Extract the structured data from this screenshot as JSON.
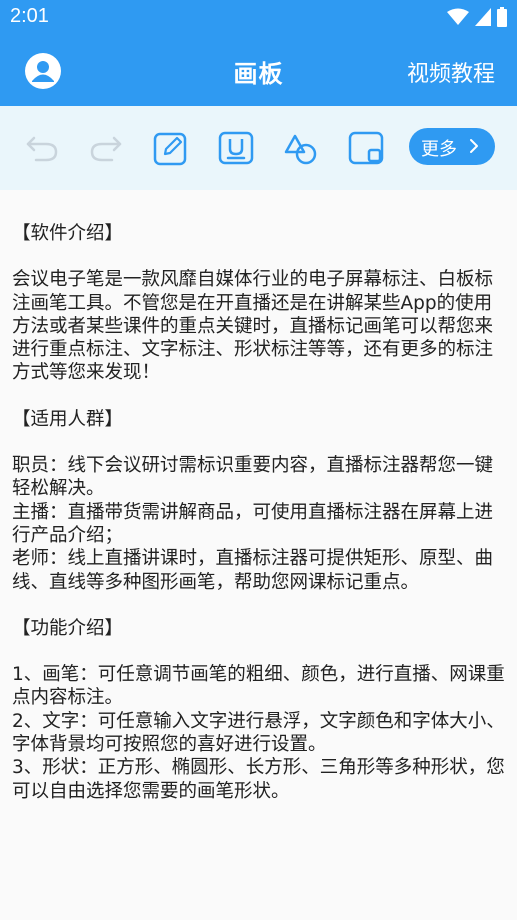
{
  "status": {
    "time": "2:01"
  },
  "header": {
    "title": "画板",
    "video_tutorial": "视频教程"
  },
  "toolbar": {
    "more_label": "更多",
    "colors": {
      "active": "#2f9af2",
      "disabled": "#c9d4dc"
    }
  },
  "content": {
    "s1_title": "【软件介绍】",
    "s1_body": "会议电子笔是一款风靡自媒体行业的电子屏幕标注、白板标注画笔工具。不管您是在开直播还是在讲解某些App的使用方法或者某些课件的重点关键时，直播标记画笔可以帮您来进行重点标注、文字标注、形状标注等等，还有更多的标注方式等您来发现！",
    "s2_title": "【适用人群】",
    "s2_item1": "职员：线下会议研讨需标识重要内容，直播标注器帮您一键轻松解决。",
    "s2_item2": "主播：直播带货需讲解商品，可使用直播标注器在屏幕上进行产品介绍；",
    "s2_item3": "老师：线上直播讲课时，直播标注器可提供矩形、原型、曲线、直线等多种图形画笔，帮助您网课标记重点。",
    "s3_title": "【功能介绍】",
    "s3_item1": "1、画笔：可任意调节画笔的粗细、颜色，进行直播、网课重点内容标注。",
    "s3_item2": "2、文字：可任意输入文字进行悬浮，文字颜色和字体大小、字体背景均可按照您的喜好进行设置。",
    "s3_item3": "3、形状：正方形、椭圆形、长方形、三角形等多种形状，您可以自由选择您需要的画笔形状。"
  }
}
